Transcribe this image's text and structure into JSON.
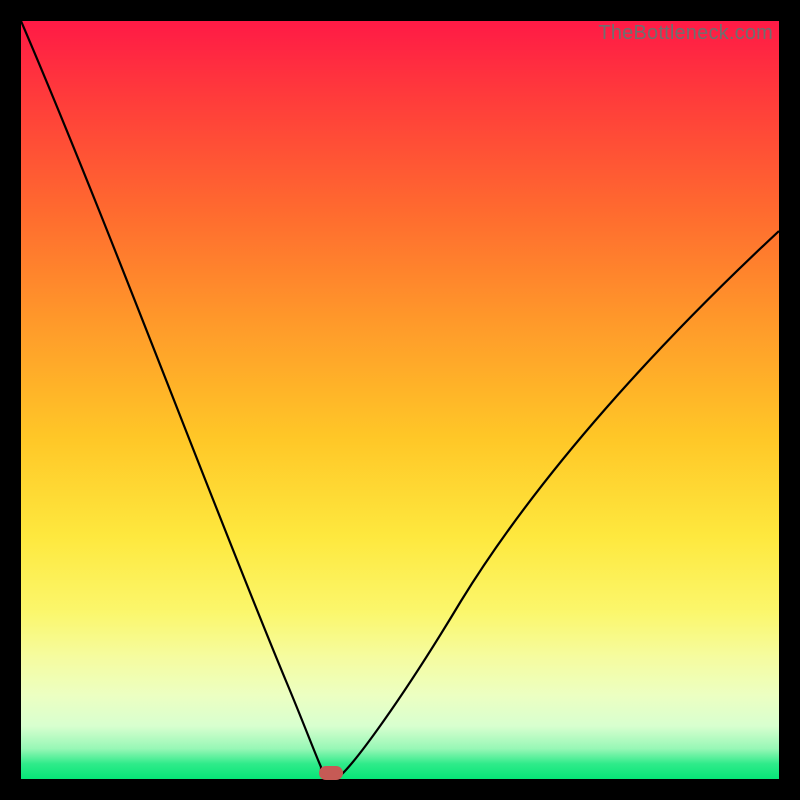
{
  "watermark": "TheBottleneck.com",
  "chart_data": {
    "type": "line",
    "title": "",
    "xlabel": "",
    "ylabel": "",
    "xlim": [
      0,
      100
    ],
    "ylim": [
      0,
      100
    ],
    "grid": false,
    "legend": false,
    "background": "red-yellow-green vertical gradient",
    "series": [
      {
        "name": "bottleneck-curve",
        "x": [
          0,
          5,
          10,
          15,
          20,
          25,
          30,
          33,
          35,
          37,
          38,
          39,
          40,
          41,
          44,
          50,
          55,
          60,
          65,
          70,
          75,
          80,
          85,
          90,
          95,
          100
        ],
        "y": [
          100,
          86,
          72,
          59,
          46,
          33,
          20,
          12,
          7,
          3,
          1,
          0,
          0,
          0,
          2,
          8,
          14,
          21,
          28,
          34,
          41,
          48,
          55,
          62,
          68,
          72
        ]
      }
    ],
    "marker": {
      "name": "optimal-point",
      "x": 40,
      "y": 0,
      "color": "#c65a55"
    }
  }
}
